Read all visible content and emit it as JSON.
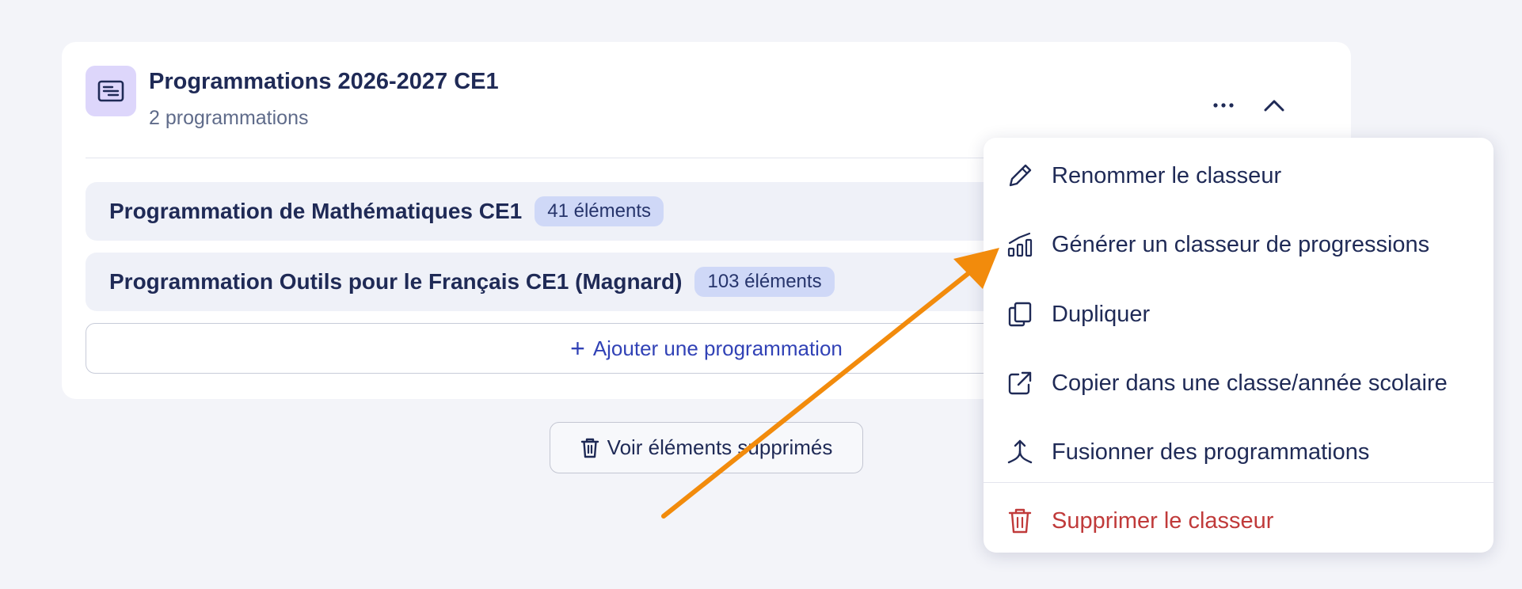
{
  "card": {
    "title": "Programmations 2026-2027 CE1",
    "subtitle": "2 programmations",
    "rows": [
      {
        "name": "Programmation de Mathématiques CE1",
        "count": "41 éléments"
      },
      {
        "name": "Programmation Outils pour le Français CE1 (Magnard)",
        "count": "103 éléments"
      }
    ],
    "add_label": "Ajouter une programmation"
  },
  "deleted_label": "Voir éléments supprimés",
  "menu": {
    "items": [
      {
        "label": "Renommer le classeur",
        "icon": "pencil-icon"
      },
      {
        "label": "Générer un classeur de progressions",
        "icon": "chart-icon"
      },
      {
        "label": "Dupliquer",
        "icon": "copy-icon"
      },
      {
        "label": "Copier dans une classe/année scolaire",
        "icon": "external-link-icon"
      },
      {
        "label": "Fusionner des programmations",
        "icon": "merge-icon"
      },
      {
        "label": "Supprimer le classeur",
        "icon": "trash-icon"
      }
    ]
  },
  "colors": {
    "accent": "#3142b6",
    "danger": "#c03a3a",
    "arrow": "#f28b0c",
    "badge": "#cfd8f7"
  }
}
